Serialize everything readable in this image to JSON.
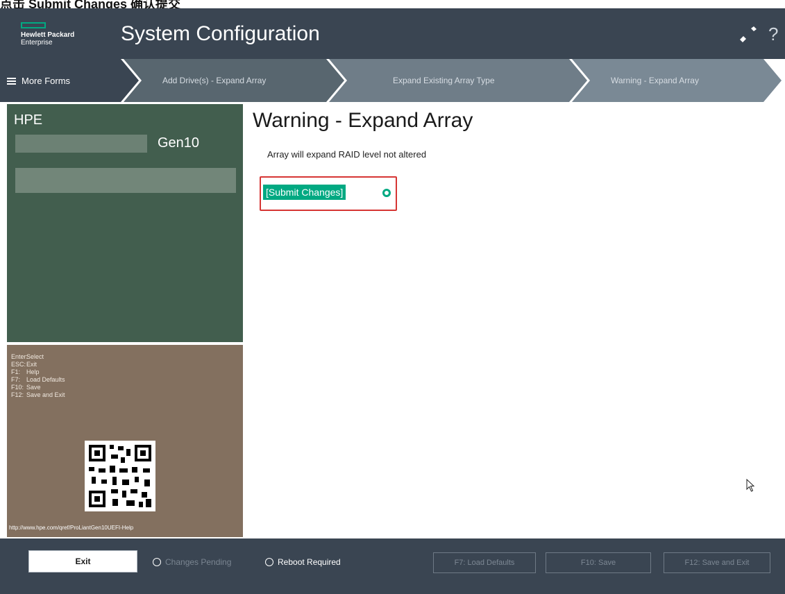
{
  "page_caption": "点击 Submit Changes 确认提交",
  "header": {
    "logo_line1": "Hewlett Packard",
    "logo_line2": "Enterprise",
    "title": "System Configuration",
    "wrench_icon": "wrench-icon",
    "help_label": "?"
  },
  "breadcrumbs": {
    "more_forms": "More Forms",
    "items": [
      "Add Drive(s) - Expand Array",
      "Expand Existing Array Type",
      "Warning - Expand Array"
    ]
  },
  "system": {
    "brand": "HPE",
    "model": "Gen10"
  },
  "keys": [
    {
      "key": "Enter:",
      "action": "Select"
    },
    {
      "key": "ESC:",
      "action": "Exit"
    },
    {
      "key": "F1:",
      "action": "Help"
    },
    {
      "key": "F7:",
      "action": "Load Defaults"
    },
    {
      "key": "F10:",
      "action": "Save"
    },
    {
      "key": "F12:",
      "action": "Save and Exit"
    }
  ],
  "help_url": "http://www.hpe.com/qref/ProLiantGen10UEFI-Help",
  "main": {
    "title": "Warning - Expand Array",
    "message": "Array will expand RAID level not altered",
    "submit_label": "[Submit Changes]"
  },
  "footer": {
    "exit_label": "Exit",
    "changes_pending": "Changes Pending",
    "reboot_required": "Reboot Required",
    "f7_label": "F7: Load Defaults",
    "f10_label": "F10: Save",
    "f12_label": "F12: Save and Exit"
  },
  "colors": {
    "accent": "#01a982",
    "header_bg": "#3a4552",
    "system_panel": "#425e4e",
    "help_panel": "#83705f",
    "highlight_frame": "#d63533"
  }
}
